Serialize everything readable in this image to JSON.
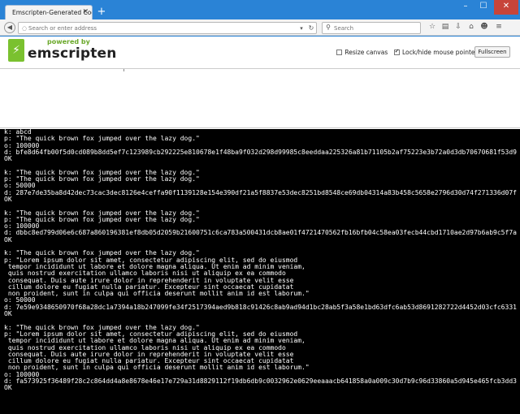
{
  "browser": {
    "tab_title": "Emscripten-Generated Code",
    "tab_close": "✕",
    "new_tab": "+",
    "url_placeholder": "Search or enter address",
    "search_placeholder": "Search",
    "window_controls": {
      "minimize": "–",
      "maximize": "☐",
      "close": "✕"
    },
    "icons": [
      "back-icon",
      "reload-icon",
      "search-icon",
      "star-icon",
      "reading-list-icon",
      "downloads-icon",
      "home-icon",
      "menu-icon"
    ]
  },
  "page": {
    "logo": {
      "powered": "powered by",
      "name": "emscripten"
    },
    "resize_canvas": {
      "label": "Resize canvas",
      "checked": false
    },
    "lock_mouse": {
      "label": "Lock/hide mouse pointer",
      "checked": true
    },
    "fullscreen_label": "Fullscreen"
  },
  "output": {
    "text": "k: abcd\np: \"The quick brown fox jumped over the lazy dog.\"\no: 100000\nd: bfe8d64fb00f5d0cd089b8dd5ef7c123989cb292225e810678e1f48ba9f032d298d99985c8eeddaa225326a81b71105b2af75223e3b72a0d3db70670681f53d9\nOK\n\nk: \"The quick brown fox jumped over the lazy dog.\"\np: \"The quick brown fox jumped over the lazy dog.\"\no: 50000\nd: 287e7de35ba8d42dec73cac3dec8126e4ceffa90f1139128e154e390df21a5f8837e53dec8251bd8548ce69db04314a83b458c5658e2796d30d74f271336d07f\nOK\n\nk: \"The quick brown fox jumped over the lazy dog.\"\np: \"The quick brown fox jumped over the lazy dog.\"\no: 100000\nd: dbbc8ed799d06e6c687a860196381ef8db05d2059b21600751c6ca783a500431dcb8ae01f4721470562fb16bfb04c58ea03fecb44cbd1710ae2d97b6ab9c5f7a\nOK\n\nk: \"The quick brown fox jumped over the lazy dog.\"\np: \"Lorem ipsum dolor sit amet, consectetur adipiscing elit, sed do eiusmod\n tempor incididunt ut labore et dolore magna aliqua. Ut enim ad minim veniam,\n quis nostrud exercitation ullamco laboris nisi ut aliquip ex ea commodo\n consequat. Duis aute irure dolor in reprehenderit in voluptate velit esse\n cillum dolore eu fugiat nulla pariatur. Excepteur sint occaecat cupidatat\n non proident, sunt in culpa qui officia deserunt mollit anim id est laborum.\"\no: 50000\nd: 7e59e9348650970f68a28dc1a7394a18b247099fe34f2517394aed9b818c91426c8ab9ad94d1bc28ab5f3a58e1bd63dfc6ab53d8691282722d4452d03cfc6331\nOK\n\nk: \"The quick brown fox jumped over the lazy dog.\"\np: \"Lorem ipsum dolor sit amet, consectetur adipiscing elit, sed do eiusmod\n tempor incididunt ut labore et dolore magna aliqua. Ut enim ad minim veniam,\n quis nostrud exercitation ullamco laboris nisi ut aliquip ex ea commodo\n consequat. Duis aute irure dolor in reprehenderit in voluptate velit esse\n cillum dolore eu fugiat nulla pariatur. Excepteur sint occaecat cupidatat\n non proident, sunt in culpa qui officia deserunt mollit anim id est laborum.\"\no: 100000\nd: fa573925f36489f28c2c864dd4a8e8678e46e17e729a31d8829112f19db6db9c0032962e0629eeaaacb641858a0a009c30d7b9c96d33860a5d945e465fcb3dd3\nOK"
  }
}
